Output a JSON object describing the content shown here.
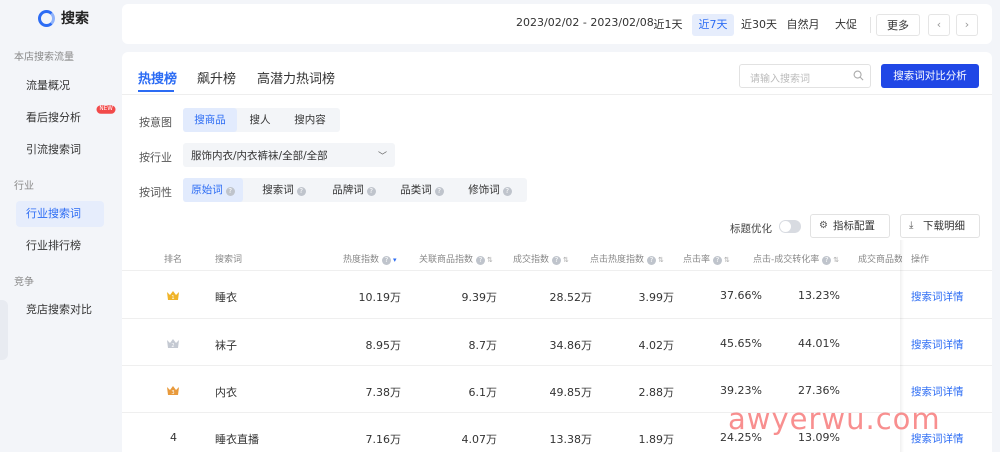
{
  "sidebar": {
    "app_title": "搜索",
    "groups": [
      {
        "title": "本店搜索流量",
        "items": [
          "流量概况",
          "看后搜分析",
          "引流搜索词"
        ]
      },
      {
        "title": "行业",
        "items": [
          "行业搜索词",
          "行业排行榜"
        ]
      },
      {
        "title": "竞争",
        "items": [
          "竞店搜索对比"
        ]
      }
    ],
    "new_badge": "NEW",
    "active_item": "行业搜索词"
  },
  "datebar": {
    "range": "2023/02/02 - 2023/02/08",
    "buttons": [
      "近1天",
      "近7天",
      "近30天",
      "自然月",
      "大促",
      "更多"
    ],
    "active": "近7天",
    "prev": "‹",
    "next": "›"
  },
  "tabs": [
    "热搜榜",
    "飙升榜",
    "高潜力热词榜"
  ],
  "active_tab": "热搜榜",
  "search": {
    "placeholder": "请输入搜索词"
  },
  "compare_button": "搜索词对比分析",
  "filters": {
    "intent_label": "按意图",
    "intent_options": [
      "搜商品",
      "搜人",
      "搜内容"
    ],
    "industry_label": "按行业",
    "industry_value": "服饰内衣/内衣裤袜/全部/全部",
    "attr_label": "按词性",
    "attr_options": [
      "原始词",
      "搜索词",
      "品牌词",
      "品类词",
      "修饰词"
    ]
  },
  "tools": {
    "toggle_label": "标题优化",
    "metric_config": "指标配置",
    "download": "下载明细"
  },
  "table": {
    "headers": [
      "排名",
      "搜索词",
      "热度指数",
      "关联商品指数",
      "成交指数",
      "点击热度指数",
      "点击率",
      "点击-成交转化率",
      "成交商品数",
      "操作"
    ],
    "rows": [
      {
        "rank": "1",
        "word": "睡衣",
        "heat": "10.19万",
        "related": "9.39万",
        "deal": "28.52万",
        "click_heat": "3.99万",
        "ctr": "37.66%",
        "cvr": "13.23%",
        "action": "搜索词详情"
      },
      {
        "rank": "2",
        "word": "袜子",
        "heat": "8.95万",
        "related": "8.7万",
        "deal": "34.86万",
        "click_heat": "4.02万",
        "ctr": "45.65%",
        "cvr": "44.01%",
        "action": "搜索词详情"
      },
      {
        "rank": "3",
        "word": "内衣",
        "heat": "7.38万",
        "related": "6.1万",
        "deal": "49.85万",
        "click_heat": "2.88万",
        "ctr": "39.23%",
        "cvr": "27.36%",
        "action": "搜索词详情"
      },
      {
        "rank": "4",
        "word": "睡衣直播",
        "heat": "7.16万",
        "related": "4.07万",
        "deal": "13.38万",
        "click_heat": "1.89万",
        "ctr": "24.25%",
        "cvr": "13.09%",
        "action": "搜索词详情"
      }
    ]
  },
  "colors": {
    "accent": "#2c6cf4",
    "primary_button": "#2047e6",
    "gold": "#f0b429",
    "silver": "#c4c9d2",
    "bronze": "#e89a3c"
  },
  "watermark": "awyerwu.com"
}
